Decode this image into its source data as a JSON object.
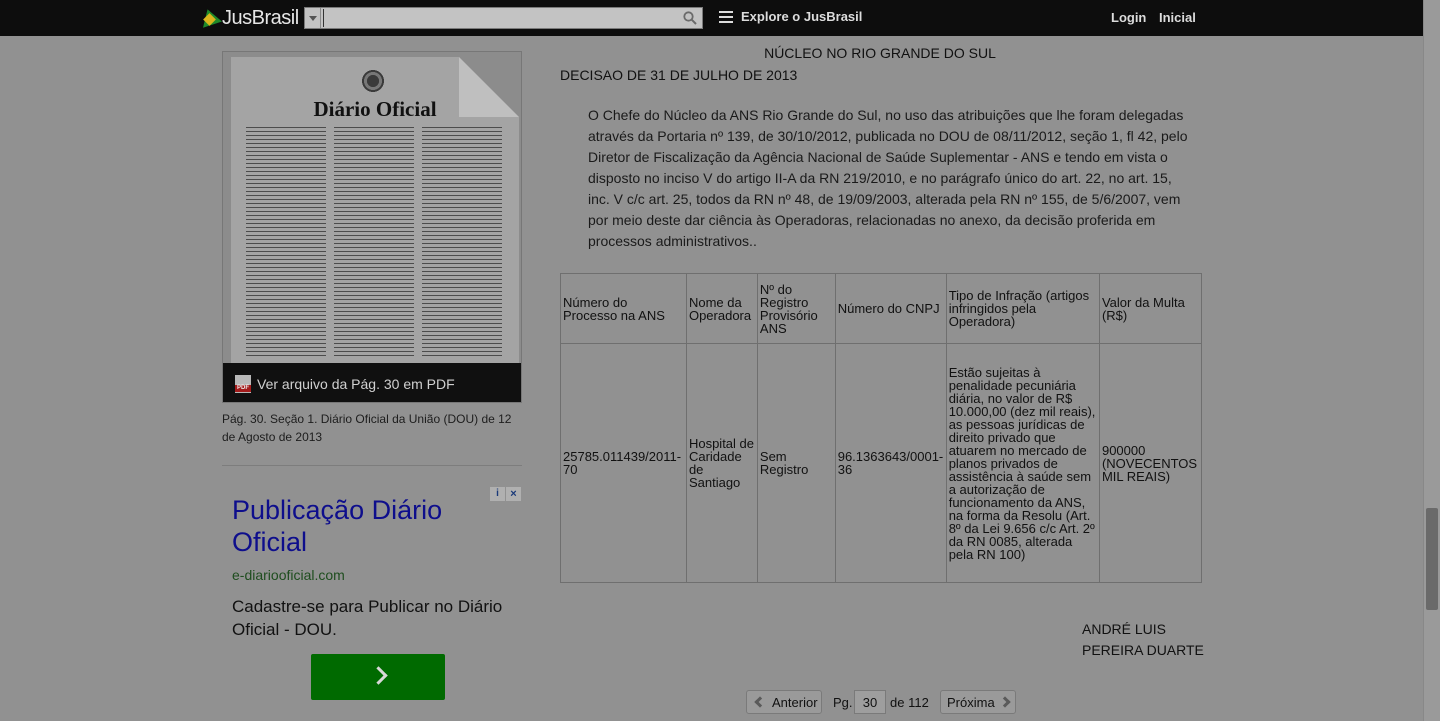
{
  "header": {
    "logo_text": "JusBrasil",
    "search_value": "",
    "explore_label": "Explore o JusBrasil",
    "login_label": "Login",
    "inicial_label": "Inicial"
  },
  "sidebar": {
    "thumbnail_title": "Diário Oficial",
    "pdf_link_label": "Ver arquivo da Pág. 30 em PDF",
    "caption": "Pág. 30. Seção 1. Diário Oficial da União (DOU) de 12 de Agosto de 2013"
  },
  "ad": {
    "title": "Publicação Diário Oficial",
    "url": "e-diariooficial.com",
    "text": "Cadastre-se para Publicar no Diário Oficial - DOU."
  },
  "document": {
    "heading": "NÚCLEO NO RIO GRANDE DO SUL",
    "decision": "DECISAO DE 31 DE JULHO DE 2013",
    "paragraph": "O Chefe do Núcleo da ANS Rio Grande do Sul, no uso das atribuições que lhe foram delegadas através da Portaria nº 139, de 30/10/2012, publicada no DOU de 08/11/2012, seção 1, fl 42, pelo Diretor de Fiscalização da Agência Nacional de Saúde Suplementar - ANS e tendo em vista o disposto no inciso V do artigo II-A da RN 219/2010, e no parágrafo único do art. 22, no art. 15, inc. V c/c art. 25, todos da RN nº 48, de 19/09/2003, alterada pela RN nº 155, de 5/6/2007, vem por meio deste dar ciência às Operadoras, relacionadas no anexo, da decisão proferida em processos administrativos..",
    "table": {
      "headers": [
        "Número do Processo na ANS",
        "Nome da Operadora",
        "Nº do Registro Provisório ANS",
        "Número do CNPJ",
        "Tipo de Infração (artigos infringidos pela Operadora)",
        "Valor da Multa (R$)"
      ],
      "rows": [
        [
          "25785.011439/2011-70",
          "Hospital de Caridade de Santiago",
          "Sem Registro",
          "96.1363643/0001-36",
          "Estão sujeitas à penalidade pecuniária diária, no valor de R$ 10.000,00 (dez mil reais), as pessoas jurídicas de direito privado que atuarem no mercado de planos privados de assistência à saúde sem a autorização de funcionamento da ANS, na forma da Resolu (Art. 8º da Lei 9.656 c/c Art. 2º da RN 0085, alterada pela RN 100)",
          "900000 (NOVECENTOS MIL REAIS)"
        ]
      ]
    },
    "signature": "ANDRÉ LUIS PEREIRA DUARTE"
  },
  "pagination": {
    "prev_label": "Anterior",
    "page_label": "Pg.",
    "current_page": "30",
    "total_label": "de 112",
    "next_label": "Próxima"
  }
}
